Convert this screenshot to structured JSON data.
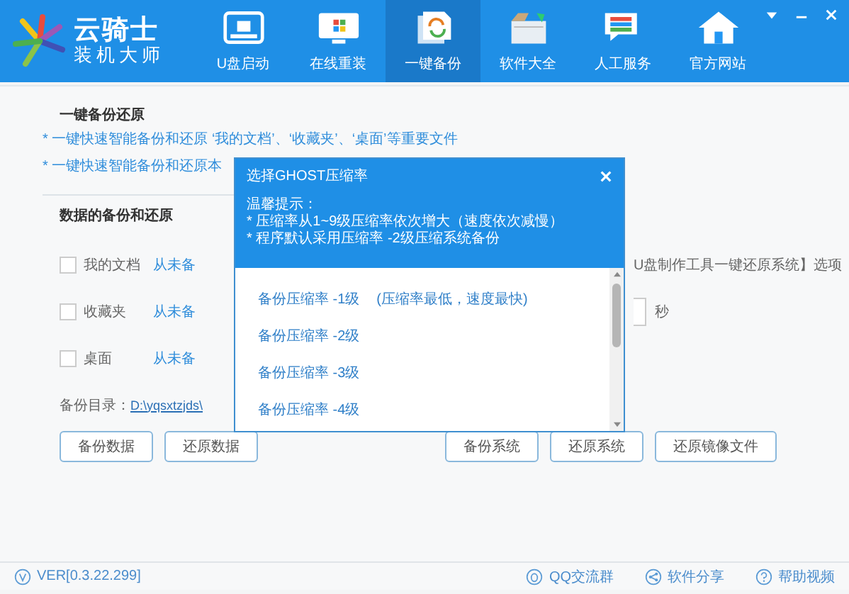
{
  "app": {
    "logo_title": "云骑士",
    "logo_subtitle": "装机大师"
  },
  "nav": [
    {
      "label": "U盘启动",
      "selected": false
    },
    {
      "label": "在线重装",
      "selected": false
    },
    {
      "label": "一键备份",
      "selected": true
    },
    {
      "label": "软件大全",
      "selected": false
    },
    {
      "label": "人工服务",
      "selected": false
    },
    {
      "label": "官方网站",
      "selected": false
    }
  ],
  "page": {
    "title": "一键备份还原",
    "notes": [
      "* 一键快速智能备份和还原 ‘我的文档’、‘收藏夹’、‘桌面’等重要文件",
      "* 一键快速智能备份和还原本"
    ],
    "section_title": "数据的备份和还原",
    "items": [
      {
        "label": "我的文档",
        "checked": false,
        "status": "从未备"
      },
      {
        "label": "收藏夹",
        "checked": false,
        "status": "从未备"
      },
      {
        "label": "桌面",
        "checked": false,
        "status": "从未备"
      }
    ],
    "option_text": "U盘制作工具一键还原系统】选项",
    "seconds_unit": "秒",
    "backup_dir_label": "备份目录：",
    "backup_dir": "D:\\yqsxtzjds\\",
    "buttons_left": [
      "备份数据",
      "还原数据"
    ],
    "buttons_right": [
      "备份系统",
      "还原系统",
      "还原镜像文件"
    ]
  },
  "dialog": {
    "title": "选择GHOST压缩率",
    "tip_title": "温馨提示：",
    "tips": [
      "* 压缩率从1~9级压缩率依次增大（速度依次减慢）",
      "* 程序默认采用压缩率 -2级压缩系统备份"
    ],
    "options": [
      {
        "label": "备份压缩率 -1级",
        "note": "(压缩率最低，速度最快)"
      },
      {
        "label": "备份压缩率 -2级"
      },
      {
        "label": "备份压缩率 -3级"
      },
      {
        "label": "备份压缩率 -4级"
      }
    ]
  },
  "footer": {
    "version": "VER[0.3.22.299]",
    "links": [
      {
        "label": "QQ交流群"
      },
      {
        "label": "软件分享"
      },
      {
        "label": "帮助视频"
      }
    ]
  }
}
